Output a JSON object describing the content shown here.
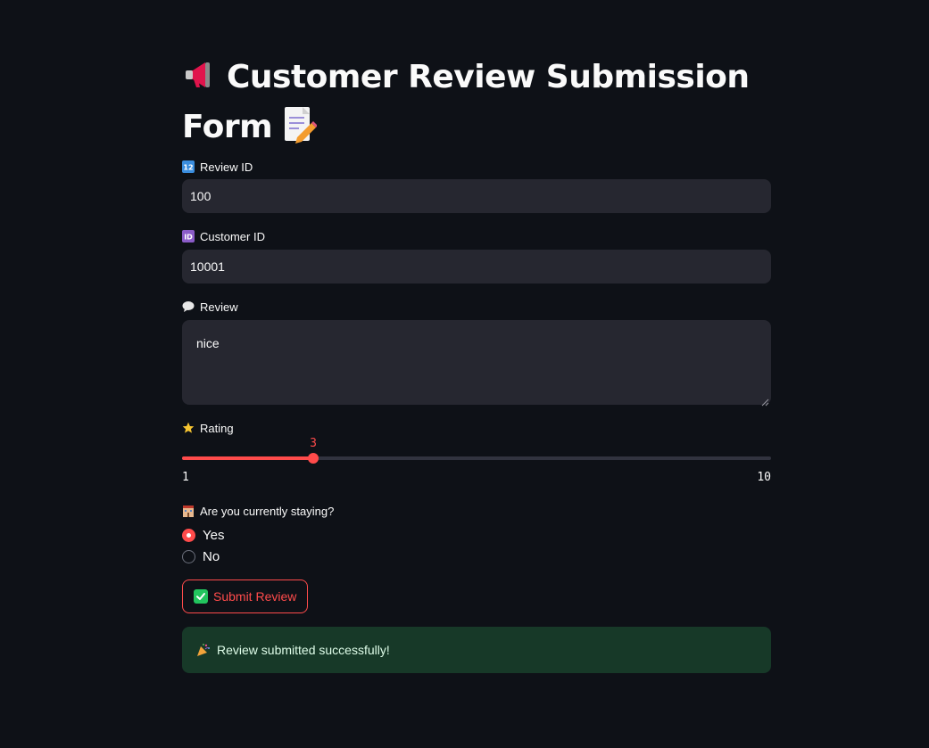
{
  "form": {
    "title_line1": "Customer Review Submission",
    "title_line2": "Form",
    "title_icon": "megaphone-icon",
    "title_icon_end": "memo-icon",
    "fields": {
      "review_id": {
        "label": "Review ID",
        "icon": "numbers-icon",
        "value": "100"
      },
      "customer_id": {
        "label": "Customer ID",
        "icon": "id-icon",
        "value": "10001"
      },
      "review": {
        "label": "Review",
        "icon": "speech-bubble-icon",
        "value": "nice"
      }
    },
    "rating": {
      "label": "Rating",
      "icon": "star-icon",
      "value": 3,
      "value_label": "3",
      "min": 1,
      "max": 10,
      "min_label": "1",
      "max_label": "10"
    },
    "staying": {
      "label": "Are you currently staying?",
      "icon": "hotel-icon",
      "options": [
        "Yes",
        "No"
      ],
      "selected": "Yes"
    },
    "submit_label": "Submit Review",
    "success_message": "Review submitted successfully!"
  },
  "colors": {
    "background": "#0e1117",
    "input_bg": "#262730",
    "accent": "#ff4b4b",
    "success_bg": "#173928"
  }
}
